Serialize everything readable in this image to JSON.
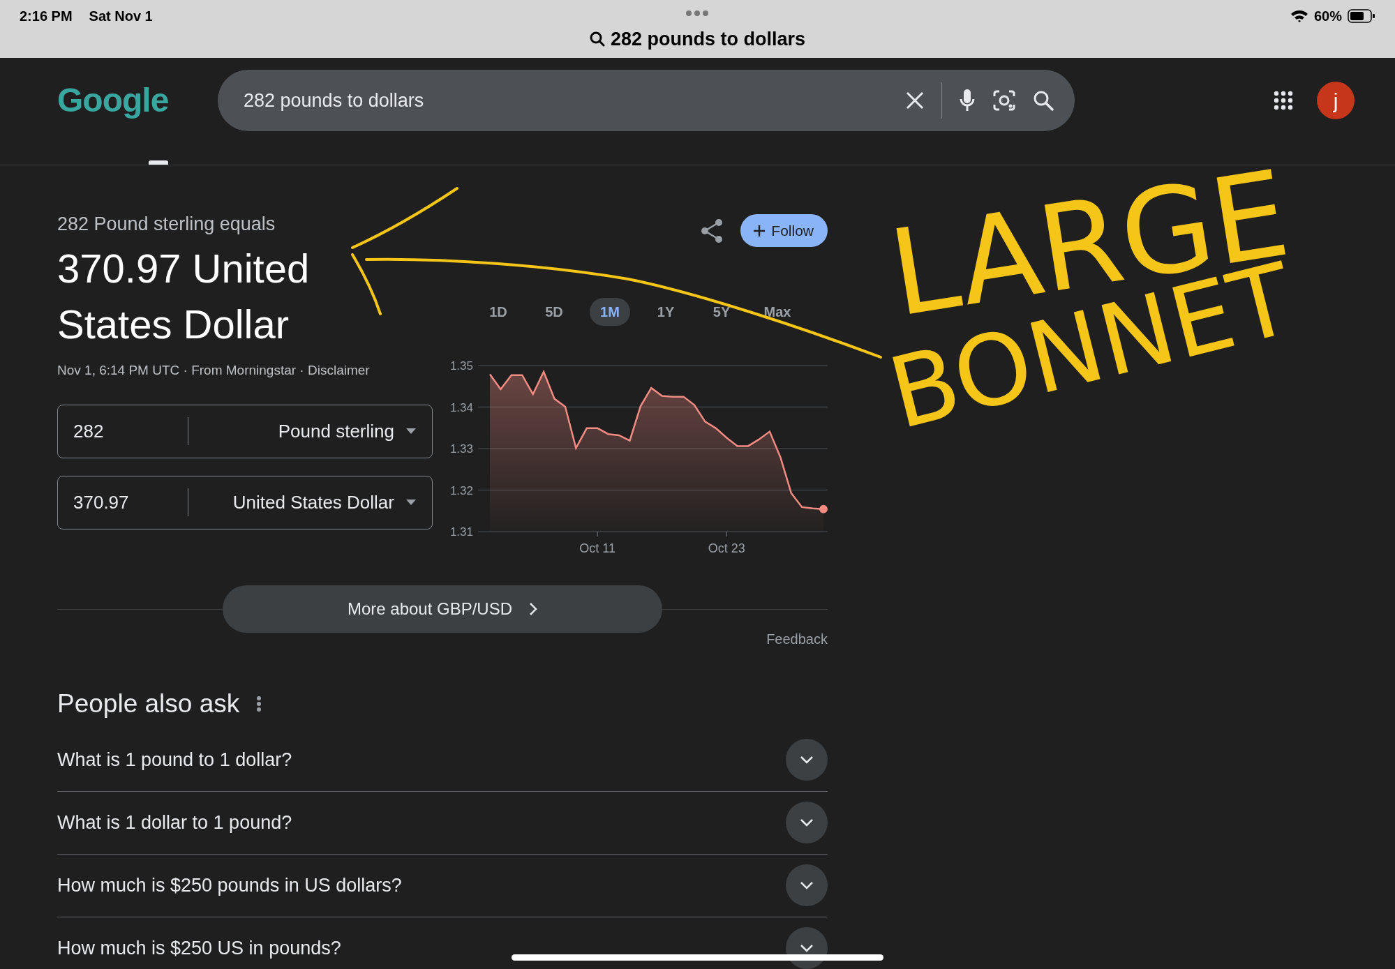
{
  "status_bar": {
    "time": "2:16 PM",
    "date": "Sat Nov 1",
    "battery": "60%"
  },
  "address_bar": {
    "query": "282 pounds to dollars"
  },
  "header": {
    "logo": "Google",
    "search": {
      "value": "282 pounds to dollars"
    },
    "avatar": "j"
  },
  "result": {
    "subtitle": "282 Pound sterling equals",
    "amount": "370.97 United States Dollar",
    "meta": "Nov 1, 6:14 PM UTC · From Morningstar · ",
    "disclaimer": "Disclaimer",
    "follow": "Follow",
    "converter": [
      {
        "value": "282",
        "currency": "Pound sterling"
      },
      {
        "value": "370.97",
        "currency": "United States Dollar"
      }
    ],
    "ranges": [
      {
        "label": "1D",
        "selected": false
      },
      {
        "label": "5D",
        "selected": false
      },
      {
        "label": "1M",
        "selected": true
      },
      {
        "label": "1Y",
        "selected": false
      },
      {
        "label": "5Y",
        "selected": false
      },
      {
        "label": "Max",
        "selected": false
      }
    ],
    "chart_data": {
      "type": "area",
      "categories": [
        null,
        null,
        null,
        null,
        null,
        null,
        null,
        null,
        null,
        null,
        "Oct 11",
        null,
        null,
        null,
        null,
        null,
        null,
        null,
        null,
        null,
        null,
        null,
        "Oct 23",
        null,
        null,
        null,
        null,
        null,
        null,
        null,
        null,
        null
      ],
      "series": [
        {
          "color": "#f28b82",
          "values": [
            1.3479,
            1.3443,
            1.3477,
            1.3477,
            1.3431,
            1.3485,
            1.342,
            1.3401,
            1.3301,
            1.3349,
            1.3349,
            1.3335,
            1.3332,
            1.3319,
            1.3402,
            1.3446,
            1.3427,
            1.3425,
            1.3425,
            1.3405,
            1.3365,
            1.3349,
            1.3326,
            1.3306,
            1.3306,
            1.3322,
            1.3341,
            1.3279,
            1.3193,
            1.3159,
            1.3156,
            1.3154
          ]
        }
      ],
      "ylim": [
        1.31,
        1.35
      ],
      "grid": true,
      "yticks": [
        1.31,
        1.32,
        1.33,
        1.34,
        1.35
      ]
    },
    "more_button": "More about GBP/USD",
    "feedback": "Feedback"
  },
  "people_also_ask": {
    "title": "People also ask",
    "questions": [
      "What is 1 pound to 1 dollar?",
      "What is 1 dollar to 1 pound?",
      "How much is $250 pounds in US dollars?",
      "How much is $250 US in pounds?"
    ]
  },
  "annotation": {
    "lines": [
      "LARGE",
      "BONNET"
    ]
  }
}
